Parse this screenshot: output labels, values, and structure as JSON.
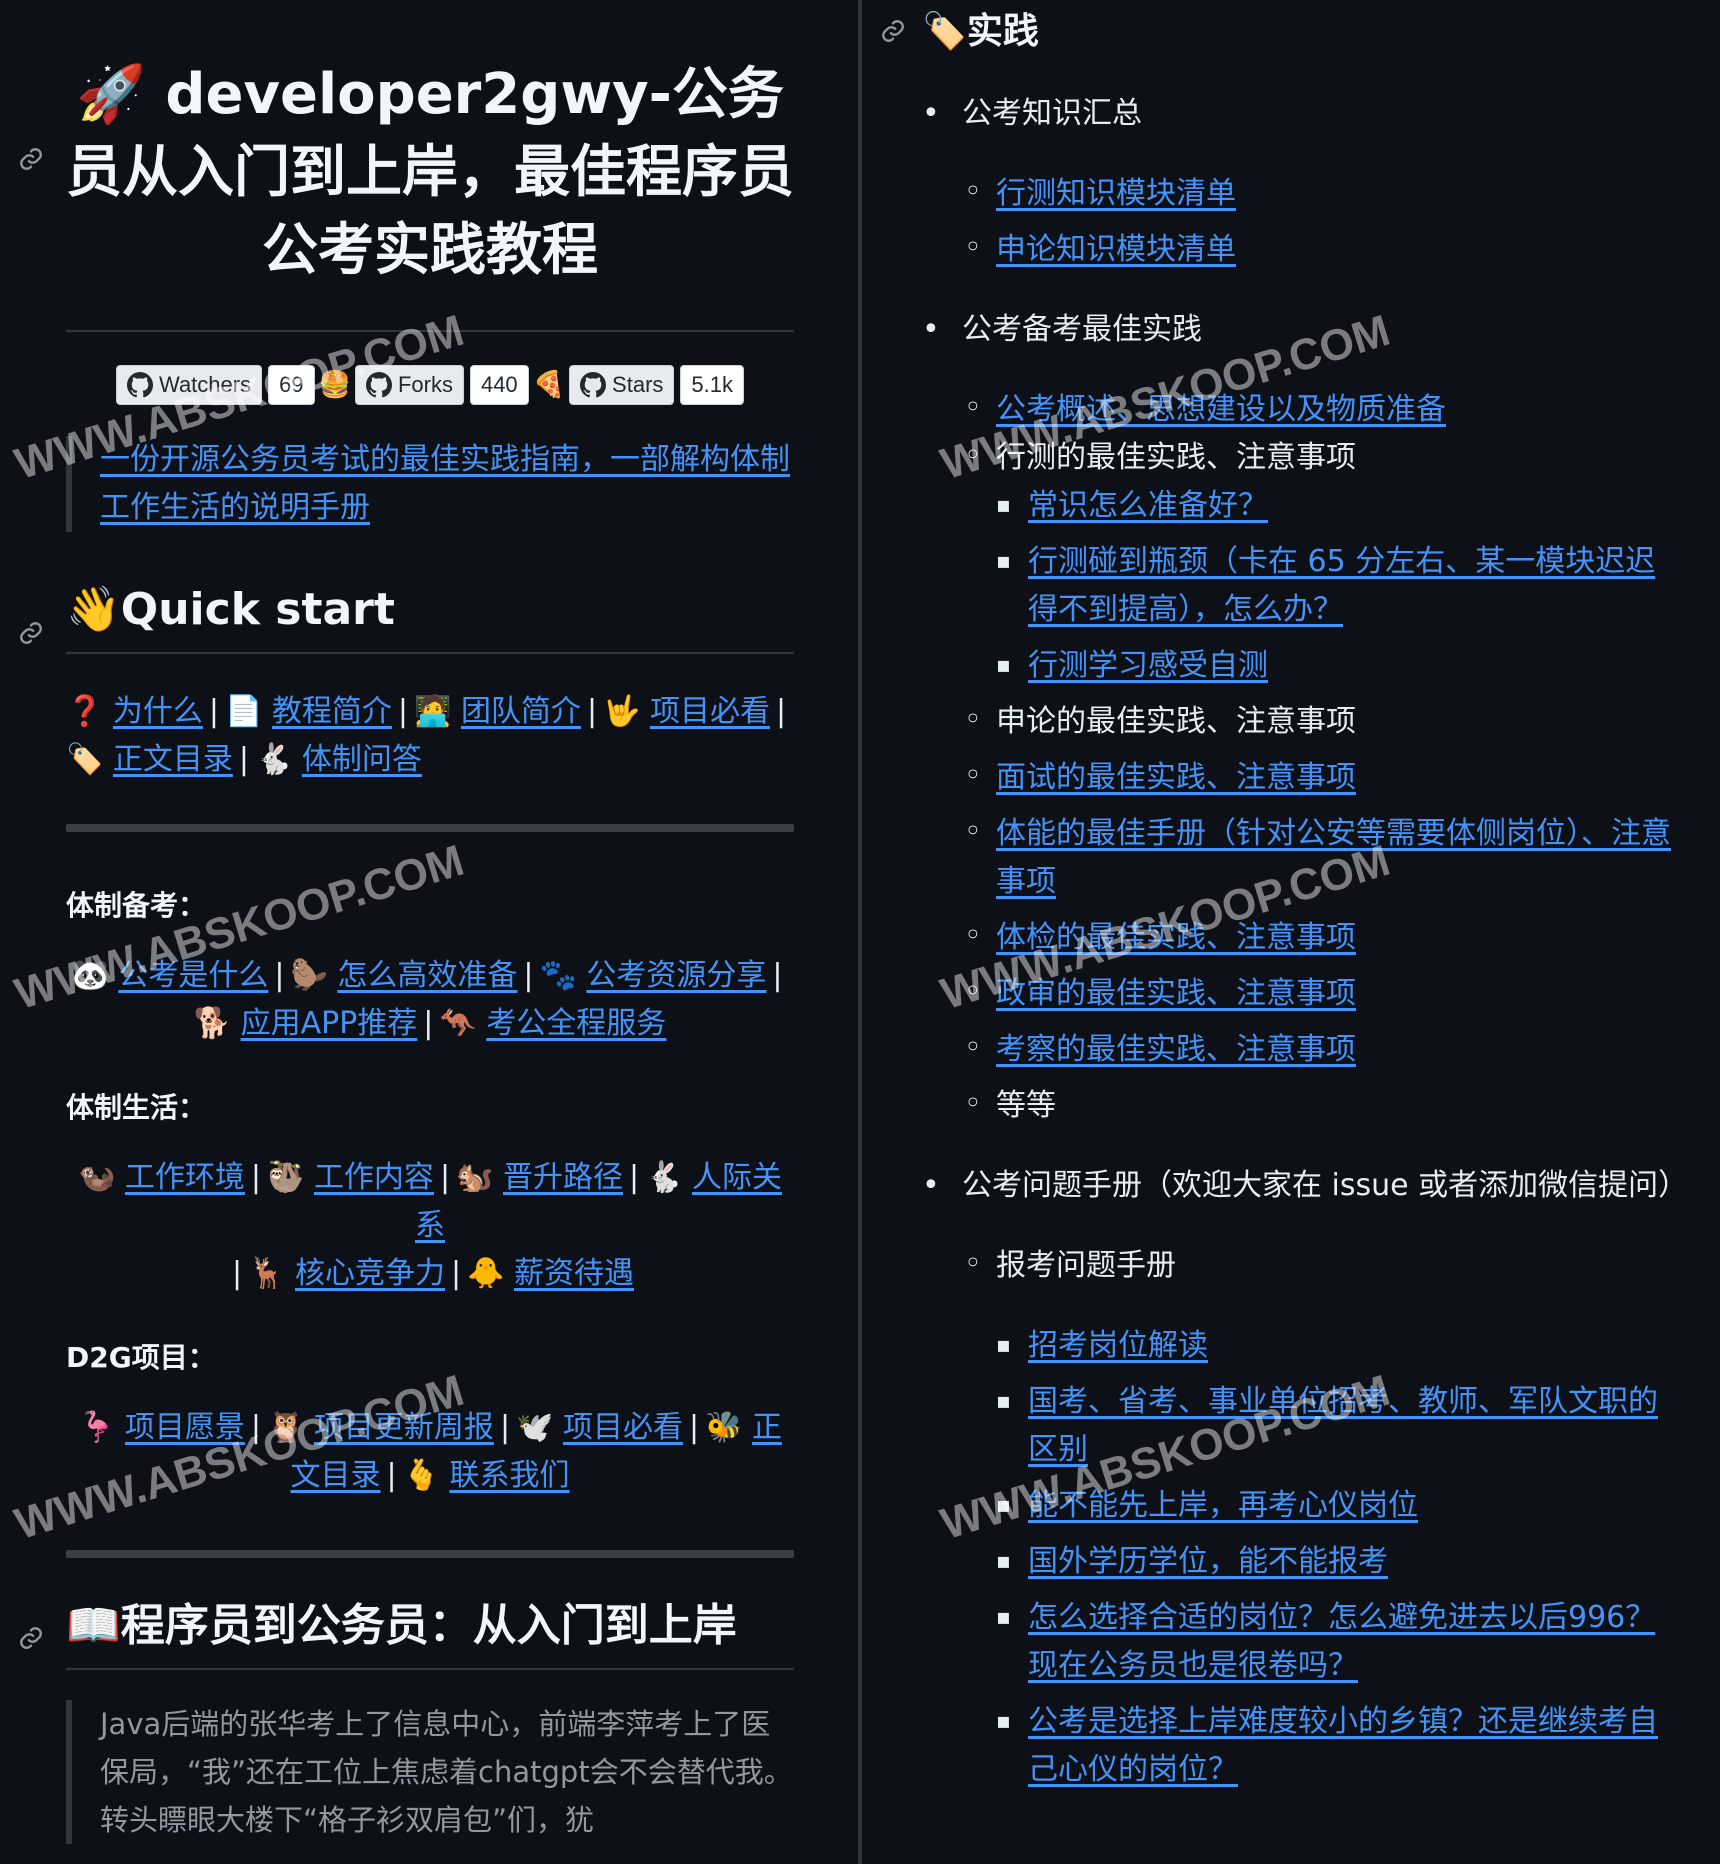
{
  "title": "developer2gwy-公务员从入门到上岸，最佳程序员公考实践教程",
  "title_emoji": "🚀",
  "badges": [
    {
      "label": "Watchers",
      "value": "69",
      "after": "🍔"
    },
    {
      "label": "Forks",
      "value": "440",
      "after": "🍕"
    },
    {
      "label": "Stars",
      "value": "5.1k",
      "after": ""
    }
  ],
  "tagline": "一份开源公务员考试的最佳实践指南，一部解构体制工作生活的说明手册",
  "quickstart": {
    "heading": "Quick start",
    "emoji": "👋",
    "nav": [
      {
        "emoji": "❓",
        "text": "为什么"
      },
      {
        "emoji": "📄",
        "text": "教程简介"
      },
      {
        "emoji": "🧑‍💻",
        "text": "团队简介"
      },
      {
        "emoji": "🤟",
        "text": "项目必看"
      },
      {
        "emoji": "🏷️",
        "text": "正文目录"
      },
      {
        "emoji": "🐇",
        "text": "体制问答"
      }
    ]
  },
  "sections": [
    {
      "label": "体制备考：",
      "items": [
        {
          "emoji": "🐼",
          "text": "公考是什么"
        },
        {
          "emoji": "🦫",
          "text": "怎么高效准备"
        },
        {
          "emoji": "🐾",
          "text": "公考资源分享"
        },
        {
          "emoji": "🐕",
          "text": "应用APP推荐"
        },
        {
          "emoji": "🦘",
          "text": "考公全程服务"
        }
      ]
    },
    {
      "label": "体制生活：",
      "items": [
        {
          "emoji": "🦦",
          "text": "工作环境"
        },
        {
          "emoji": "🦥",
          "text": "工作内容"
        },
        {
          "emoji": "🐿️",
          "text": "晋升路径"
        },
        {
          "emoji": "🐇",
          "text": "人际关系"
        },
        {
          "emoji": "🦌",
          "text": "核心竞争力"
        },
        {
          "emoji": "🐥",
          "text": "薪资待遇"
        }
      ]
    },
    {
      "label": "D2G项目：",
      "items": [
        {
          "emoji": "🦩",
          "text": "项目愿景"
        },
        {
          "emoji": "🦉",
          "text": "项目更新周报"
        },
        {
          "emoji": "🕊️",
          "text": "项目必看"
        },
        {
          "emoji": "🐝",
          "text": "正文目录"
        },
        {
          "emoji": "🫰",
          "text": "联系我们"
        }
      ]
    }
  ],
  "section2": {
    "emoji": "📖",
    "heading": "程序员到公务员：从入门到上岸",
    "story": "Java后端的张华考上了信息中心，前端李萍考上了医保局，“我”还在工位上焦虑着chatgpt会不会替代我。转头瞟眼大楼下“格子衫双肩包”们，犹"
  },
  "right": {
    "emoji": "🏷️",
    "heading": "实践",
    "groups": [
      {
        "title": "公考知识汇总",
        "items": [
          {
            "text": "行测知识模块清单",
            "link": true
          },
          {
            "text": "申论知识模块清单",
            "link": true
          }
        ]
      },
      {
        "title": "公考备考最佳实践",
        "items": [
          {
            "text": "公考概述、思想建设以及物质准备",
            "link": true
          },
          {
            "text": "行测的最佳实践、注意事项",
            "link": false,
            "sub": [
              "常识怎么准备好？",
              "行测碰到瓶颈（卡在 65 分左右、某一模块迟迟得不到提高），怎么办？",
              "行测学习感受自测"
            ]
          },
          {
            "text": "申论的最佳实践、注意事项",
            "link": false
          },
          {
            "text": "面试的最佳实践、注意事项",
            "link": true
          },
          {
            "text": "体能的最佳手册（针对公安等需要体侧岗位）、注意事项",
            "link": true
          },
          {
            "text": "体检的最佳实践、注意事项",
            "link": true
          },
          {
            "text": "政审的最佳实践、注意事项",
            "link": true
          },
          {
            "text": "考察的最佳实践、注意事项",
            "link": true
          },
          {
            "text": "等等",
            "link": false
          }
        ]
      },
      {
        "title": "公考问题手册（欢迎大家在 issue 或者添加微信提问）",
        "items": [
          {
            "text": "报考问题手册",
            "link": false,
            "sub": [
              "招考岗位解读",
              "国考、省考、事业单位招考、教师、军队文职的区别",
              "能不能先上岸，再考心仪岗位",
              "国外学历学位，能不能报考",
              "怎么选择合适的岗位？怎么避免进去以后996？现在公务员也是很卷吗？",
              "公考是选择上岸难度较小的乡镇？还是继续考自己心仪的岗位？"
            ]
          }
        ]
      }
    ]
  },
  "watermark": "WWW.ABSKOOP.COM"
}
